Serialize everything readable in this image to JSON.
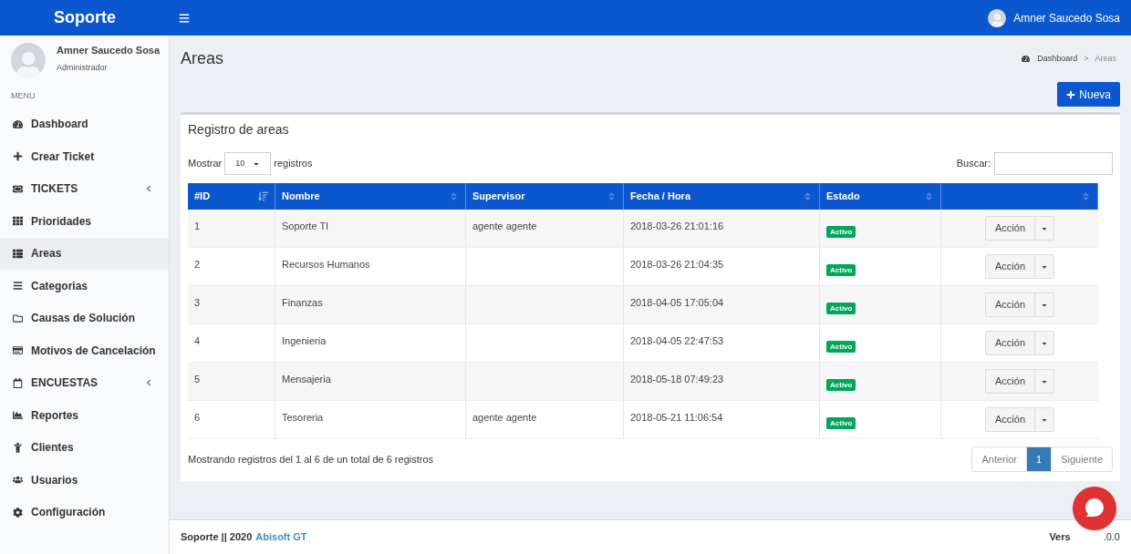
{
  "topbar": {
    "brand": "Soporte",
    "user_name": "Amner Saucedo Sosa"
  },
  "sidebar": {
    "user_name": "Amner Saucedo Sosa",
    "user_role": "Administrador",
    "menu_header": "MENU",
    "items": [
      {
        "label": "Dashboard",
        "kind": "link",
        "selected": false
      },
      {
        "label": "Crear Ticket",
        "kind": "link",
        "selected": false
      },
      {
        "label": "TICKETS",
        "kind": "group",
        "selected": false,
        "expanded": false
      },
      {
        "label": "Prioridades",
        "kind": "link",
        "selected": false
      },
      {
        "label": "Areas",
        "kind": "link",
        "selected": true
      },
      {
        "label": "Categorias",
        "kind": "link",
        "selected": false
      },
      {
        "label": "Causas de Solución",
        "kind": "link",
        "selected": false
      },
      {
        "label": "Motivos de Cancelación",
        "kind": "link",
        "selected": false
      },
      {
        "label": "ENCUESTAS",
        "kind": "group",
        "selected": false,
        "expanded": false
      },
      {
        "label": "Reportes",
        "kind": "link",
        "selected": false
      },
      {
        "label": "Clientes",
        "kind": "link",
        "selected": false
      },
      {
        "label": "Usuarios",
        "kind": "link",
        "selected": false
      },
      {
        "label": "Configuración",
        "kind": "link",
        "selected": false
      }
    ]
  },
  "page": {
    "title": "Areas",
    "breadcrumb": [
      "Dashboard",
      "Areas"
    ],
    "breadcrumb_separator": ">",
    "new_button": "Nueva"
  },
  "card": {
    "title": "Registro de areas",
    "show_label": "Mostrar",
    "page_size": "10",
    "show_suffix": "registros",
    "search_label": "Buscar:",
    "table": {
      "columns": [
        {
          "label": "#ID",
          "sorted": true
        },
        {
          "label": "Nombre",
          "sorted": false
        },
        {
          "label": "Supervisor",
          "sorted": false
        },
        {
          "label": "Fecha / Hora",
          "sorted": false
        },
        {
          "label": "Estado",
          "sorted": false
        },
        {
          "sorted": false
        }
      ],
      "rows": [
        {
          "id": "1",
          "name": "Soporte TI",
          "supervisor": "agente agente",
          "datetime": "2018-03-26 21:01:16",
          "status": "Activo",
          "action": "Acción"
        },
        {
          "id": "2",
          "name": "Recursos Humanos",
          "supervisor": "",
          "datetime": "2018-03-26 21:04:35",
          "status": "Activo",
          "action": "Acción"
        },
        {
          "id": "3",
          "name": "Finanzas",
          "supervisor": "",
          "datetime": "2018-04-05 17:05:04",
          "status": "Activo",
          "action": "Acción"
        },
        {
          "id": "4",
          "name": "Ingenieria",
          "supervisor": "",
          "datetime": "2018-04-05 22:47:53",
          "status": "Activo",
          "action": "Acción"
        },
        {
          "id": "5",
          "name": "Mensajeria",
          "supervisor": "",
          "datetime": "2018-05-18 07:49:23",
          "status": "Activo",
          "action": "Acción"
        },
        {
          "id": "6",
          "name": "Tesoreria",
          "supervisor": "agente agente",
          "datetime": "2018-05-21 11:06:54",
          "status": "Activo",
          "action": "Acción"
        }
      ]
    },
    "info": "Mostrando registros del 1 al 6 de un total de 6 registros",
    "pagination": [
      {
        "label": "Anterior",
        "selected": false
      },
      {
        "label": "1",
        "selected": true
      },
      {
        "label": "Siguiente",
        "selected": false
      }
    ]
  },
  "footer": {
    "brand": "Soporte || 2020",
    "link": "Abisoft GT",
    "version_start": "Vers",
    "version_end": ".0.0"
  }
}
